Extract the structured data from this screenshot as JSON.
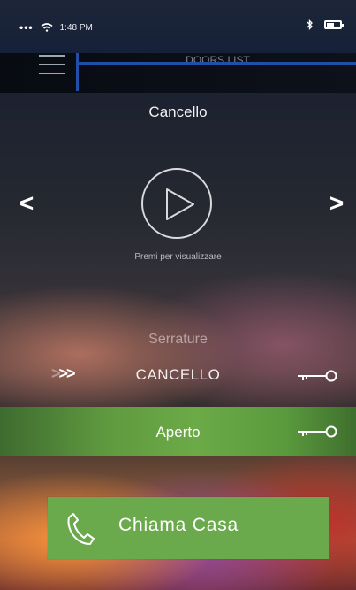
{
  "status_bar": {
    "signal_dots": "•••",
    "wifi_icon": "wifi-icon",
    "time": "1:48 PM",
    "bluetooth_icon": "bluetooth-icon",
    "battery_icon": "battery-icon",
    "battery_level": 0.6
  },
  "navbar": {
    "menu_icon": "hamburger-menu-icon",
    "title": "DOORS LIST",
    "overlay_color": "#1f4fa8"
  },
  "camera": {
    "title": "Cancello",
    "prev_icon": "chevron-left-icon",
    "prev_label": "<",
    "next_icon": "chevron-right-icon",
    "next_label": ">",
    "play_icon": "play-icon",
    "caption": "Premi per visualizzare"
  },
  "locks": {
    "header": "Serrature",
    "items": [
      {
        "chevrons_dim": ">",
        "chevrons_bright": ">>",
        "label": "CANCELLO",
        "icon": "key-icon"
      }
    ]
  },
  "status": {
    "label": "Aperto",
    "icon": "key-icon",
    "color": "#6caa47"
  },
  "call": {
    "label": "Chiama Casa",
    "icon": "phone-icon",
    "color": "#6aaa4c"
  }
}
